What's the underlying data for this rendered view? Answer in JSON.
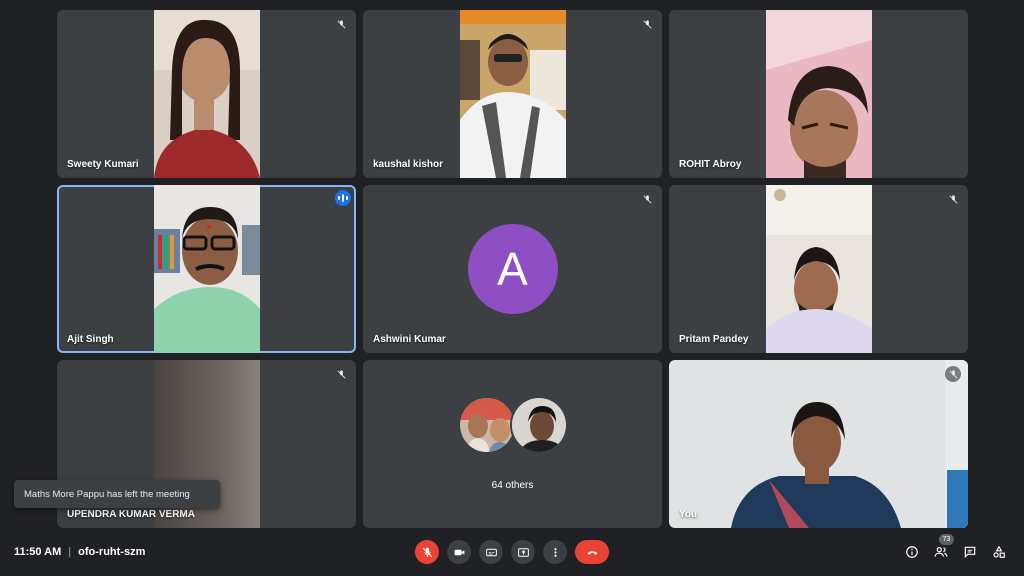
{
  "participants": [
    {
      "name": "Sweety Kumari"
    },
    {
      "name": "kaushal kishor"
    },
    {
      "name": "ROHIT Abroy"
    },
    {
      "name": "Ajit Singh"
    },
    {
      "name": "Ashwini Kumar",
      "avatar_letter": "A"
    },
    {
      "name": "Pritam Pandey"
    },
    {
      "name": "UPENDRA KUMAR VERMA"
    },
    {
      "others_label": "64 others"
    },
    {
      "name": "You"
    }
  ],
  "toast": {
    "message": "Maths More Pappu has left the meeting"
  },
  "meeting": {
    "time": "11:50 AM",
    "code": "ofo-ruht-szm"
  },
  "people_count": "73",
  "colors": {
    "background": "#202124",
    "tile": "#3c4043",
    "accent": "#8ab4f8",
    "end_call": "#ea4335",
    "avatar": "#8e4fc4"
  },
  "icons": [
    "mic-off-icon",
    "camera-icon",
    "captions-icon",
    "present-icon",
    "more-options-icon",
    "end-call-icon",
    "info-icon",
    "people-icon",
    "chat-icon",
    "activities-icon"
  ]
}
